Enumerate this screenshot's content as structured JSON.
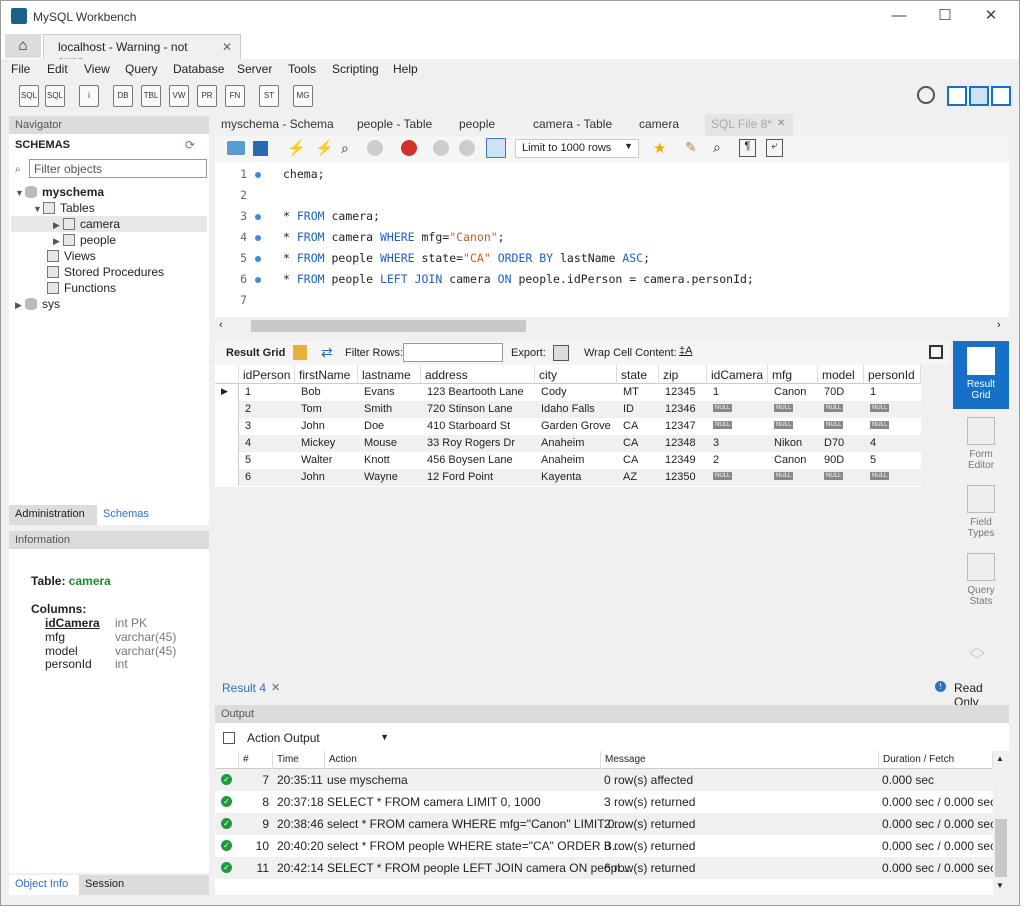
{
  "window": {
    "title": "MySQL Workbench",
    "min": "—",
    "max": "☐",
    "close": "✕"
  },
  "tabs": {
    "home": "⌂",
    "connection": "localhost - Warning - not supp...",
    "close": "✕"
  },
  "menu": [
    "File",
    "Edit",
    "View",
    "Query",
    "Database",
    "Server",
    "Tools",
    "Scripting",
    "Help"
  ],
  "toolbar_icons": [
    "SQL",
    "SQL",
    "i",
    "DB",
    "TBL",
    "VW",
    "PR",
    "FN",
    "ST",
    "MG"
  ],
  "navigator": {
    "header": "Navigator",
    "schemas_label": "SCHEMAS",
    "filter_placeholder": "Filter objects",
    "tree": {
      "schema": "myschema",
      "tables": "Tables",
      "camera": "camera",
      "people": "people",
      "views": "Views",
      "procs": "Stored Procedures",
      "funcs": "Functions",
      "sys": "sys"
    },
    "tab_admin": "Administration",
    "tab_schemas": "Schemas"
  },
  "information": {
    "header": "Information",
    "table_label": "Table:",
    "table_name": "camera",
    "columns_label": "Columns:",
    "columns": [
      {
        "name": "idCamera",
        "type": "int PK"
      },
      {
        "name": "mfg",
        "type": "varchar(45)"
      },
      {
        "name": "model",
        "type": "varchar(45)"
      },
      {
        "name": "personId",
        "type": "int"
      }
    ],
    "tab_object": "Object Info",
    "tab_session": "Session"
  },
  "editor_tabs": [
    "myschema - Schema",
    "people - Table",
    "people",
    "camera - Table",
    "camera",
    "SQL File 8*"
  ],
  "editor_tab_close": "✕",
  "limit_select": "Limit to 1000 rows",
  "code": {
    "l1": "chema;",
    "l3_a": "* ",
    "l3_kw": "FROM",
    "l3_b": " camera;",
    "l4_a": "* ",
    "l4_kw1": "FROM",
    "l4_b": " camera ",
    "l4_kw2": "WHERE",
    "l4_c": " mfg=",
    "l4_str": "\"Canon\"",
    "l4_d": ";",
    "l5_a": "* ",
    "l5_kw1": "FROM",
    "l5_b": " people ",
    "l5_kw2": "WHERE",
    "l5_c": " state=",
    "l5_str": "\"CA\"",
    "l5_sp": " ",
    "l5_kw3": "ORDER BY",
    "l5_d": " lastName ",
    "l5_kw4": "ASC",
    "l5_e": ";",
    "l6_a": "* ",
    "l6_kw1": "FROM",
    "l6_b": " people ",
    "l6_kw2": "LEFT JOIN",
    "l6_c": " camera ",
    "l6_kw3": "ON",
    "l6_d": " people.idPerson = camera.personId;"
  },
  "line_numbers": [
    "1",
    "2",
    "3",
    "4",
    "5",
    "6",
    "7"
  ],
  "result_toolbar": {
    "result_grid": "Result Grid",
    "filter_rows": "Filter Rows:",
    "export": "Export:",
    "wrap": "Wrap Cell Content:"
  },
  "grid": {
    "columns": [
      "idPerson",
      "firstName",
      "lastname",
      "address",
      "city",
      "state",
      "zip",
      "idCamera",
      "mfg",
      "model",
      "personId"
    ],
    "null_label": "NULL",
    "rows": [
      [
        "1",
        "Bob",
        "Evans",
        "123 Beartooth Lane",
        "Cody",
        "MT",
        "12345",
        "1",
        "Canon",
        "70D",
        "1"
      ],
      [
        "2",
        "Tom",
        "Smith",
        "720 Stinson Lane",
        "Idaho Falls",
        "ID",
        "12346",
        "NULL",
        "NULL",
        "NULL",
        "NULL"
      ],
      [
        "3",
        "John",
        "Doe",
        "410 Starboard St",
        "Garden Grove",
        "CA",
        "12347",
        "NULL",
        "NULL",
        "NULL",
        "NULL"
      ],
      [
        "4",
        "Mickey",
        "Mouse",
        "33 Roy Rogers Dr",
        "Anaheim",
        "CA",
        "12348",
        "3",
        "Nikon",
        "D70",
        "4"
      ],
      [
        "5",
        "Walter",
        "Knott",
        "456 Boysen Lane",
        "Anaheim",
        "CA",
        "12349",
        "2",
        "Canon",
        "90D",
        "5"
      ],
      [
        "6",
        "John",
        "Wayne",
        "12 Ford Point",
        "Kayenta",
        "AZ",
        "12350",
        "NULL",
        "NULL",
        "NULL",
        "NULL"
      ]
    ]
  },
  "side_buttons": [
    {
      "l1": "Result",
      "l2": "Grid"
    },
    {
      "l1": "Form",
      "l2": "Editor"
    },
    {
      "l1": "Field",
      "l2": "Types"
    },
    {
      "l1": "Query",
      "l2": "Stats"
    }
  ],
  "result_tab": "Result 4",
  "read_only": "Read Only",
  "output": {
    "header": "Output",
    "selector": "Action Output",
    "columns": [
      "#",
      "Time",
      "Action",
      "Message",
      "Duration / Fetch"
    ],
    "rows": [
      {
        "n": "7",
        "time": "20:35:11",
        "action": "use myschema",
        "message": "0 row(s) affected",
        "duration": "0.000 sec"
      },
      {
        "n": "8",
        "time": "20:37:18",
        "action": "SELECT * FROM camera LIMIT 0, 1000",
        "message": "3 row(s) returned",
        "duration": "0.000 sec / 0.000 sec"
      },
      {
        "n": "9",
        "time": "20:38:46",
        "action": "select * FROM camera WHERE mfg=\"Canon\" LIMIT 0...",
        "message": "2 row(s) returned",
        "duration": "0.000 sec / 0.000 sec"
      },
      {
        "n": "10",
        "time": "20:40:20",
        "action": "select * FROM people WHERE state=\"CA\" ORDER B...",
        "message": "3 row(s) returned",
        "duration": "0.000 sec / 0.000 sec"
      },
      {
        "n": "11",
        "time": "20:42:14",
        "action": "SELECT * FROM people LEFT JOIN camera ON peopl...",
        "message": "6 row(s) returned",
        "duration": "0.000 sec / 0.000 sec"
      }
    ]
  }
}
